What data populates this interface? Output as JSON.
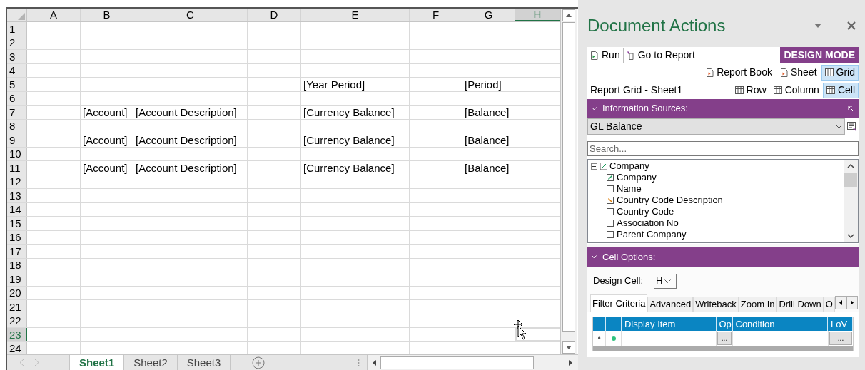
{
  "spreadsheet": {
    "columns": [
      {
        "label": "A",
        "selected": false
      },
      {
        "label": "B",
        "selected": false
      },
      {
        "label": "C",
        "selected": false
      },
      {
        "label": "D",
        "selected": false
      },
      {
        "label": "E",
        "selected": false
      },
      {
        "label": "F",
        "selected": false
      },
      {
        "label": "G",
        "selected": false
      },
      {
        "label": "H",
        "selected": true
      }
    ],
    "rows": [
      {
        "label": "1",
        "selected": false,
        "cells": []
      },
      {
        "label": "2",
        "selected": false,
        "cells": []
      },
      {
        "label": "3",
        "selected": false,
        "cells": []
      },
      {
        "label": "4",
        "selected": false,
        "cells": []
      },
      {
        "label": "5",
        "selected": false,
        "cells": [
          "",
          "",
          "",
          "",
          "[Year Period]",
          "",
          "[Period]"
        ]
      },
      {
        "label": "6",
        "selected": false,
        "cells": []
      },
      {
        "label": "7",
        "selected": false,
        "cells": [
          "",
          "[Account]",
          "[Account Description]",
          "",
          "[Currency Balance]",
          "",
          "[Balance]"
        ]
      },
      {
        "label": "8",
        "selected": false,
        "cells": []
      },
      {
        "label": "9",
        "selected": false,
        "cells": [
          "",
          "[Account]",
          "[Account Description]",
          "",
          "[Currency Balance]",
          "",
          "[Balance]"
        ]
      },
      {
        "label": "10",
        "selected": false,
        "cells": []
      },
      {
        "label": "11",
        "selected": false,
        "cells": [
          "",
          "[Account]",
          "[Account Description]",
          "",
          "[Currency Balance]",
          "",
          "[Balance]"
        ]
      },
      {
        "label": "12",
        "selected": false,
        "cells": []
      },
      {
        "label": "13",
        "selected": false,
        "cells": []
      },
      {
        "label": "14",
        "selected": false,
        "cells": []
      },
      {
        "label": "15",
        "selected": false,
        "cells": []
      },
      {
        "label": "16",
        "selected": false,
        "cells": []
      },
      {
        "label": "17",
        "selected": false,
        "cells": []
      },
      {
        "label": "18",
        "selected": false,
        "cells": []
      },
      {
        "label": "19",
        "selected": false,
        "cells": []
      },
      {
        "label": "20",
        "selected": false,
        "cells": []
      },
      {
        "label": "21",
        "selected": false,
        "cells": []
      },
      {
        "label": "22",
        "selected": false,
        "cells": []
      },
      {
        "label": "23",
        "selected": true,
        "cells": []
      },
      {
        "label": "24",
        "selected": false,
        "cells": []
      }
    ]
  },
  "sheet_tabs": [
    {
      "label": "Sheet1",
      "selected": true
    },
    {
      "label": "Sheet2",
      "selected": false
    },
    {
      "label": "Sheet3",
      "selected": false
    }
  ],
  "task_pane": {
    "title": "Document Actions",
    "actions": [
      {
        "label": "Run"
      },
      {
        "label": "Go to Report"
      }
    ],
    "mode_badge": "DESIGN MODE",
    "scope_buttons": [
      {
        "label": "Report Book",
        "selected": false
      },
      {
        "label": "Sheet",
        "selected": false
      },
      {
        "label": "Grid",
        "selected": true
      }
    ],
    "context_label": "Report Grid - Sheet1",
    "target_buttons": [
      {
        "label": "Row",
        "selected": false
      },
      {
        "label": "Column",
        "selected": false
      },
      {
        "label": "Cell",
        "selected": true
      }
    ],
    "information_sources": {
      "header": "Information Sources:",
      "source": "GL Balance",
      "search_placeholder": "Search...",
      "tree": {
        "label": "Company",
        "expanded": true,
        "children": [
          {
            "label": "Company",
            "kind": "key"
          },
          {
            "label": "Name",
            "kind": "field"
          },
          {
            "label": "Country Code Description",
            "kind": "reference"
          },
          {
            "label": "Country Code",
            "kind": "field"
          },
          {
            "label": "Association No",
            "kind": "field"
          },
          {
            "label": "Parent Company",
            "kind": "field"
          }
        ]
      }
    },
    "cell_options": {
      "header": "Cell Options:",
      "design_cell_label": "Design Cell:",
      "design_cell_value": "H",
      "tabs": [
        {
          "label": "Filter Criteria",
          "selected": true
        },
        {
          "label": "Advanced",
          "selected": false
        },
        {
          "label": "Writeback",
          "selected": false
        },
        {
          "label": "Zoom In",
          "selected": false
        },
        {
          "label": "Drill Down",
          "selected": false
        },
        {
          "label": "O",
          "selected": false
        }
      ],
      "filter_grid": {
        "columns": [
          "Display Item",
          "Op",
          "Condition",
          "LoV"
        ],
        "rows": [
          {
            "indicator": "•",
            "op_button": "...",
            "lov_button": "..."
          }
        ]
      }
    }
  }
}
